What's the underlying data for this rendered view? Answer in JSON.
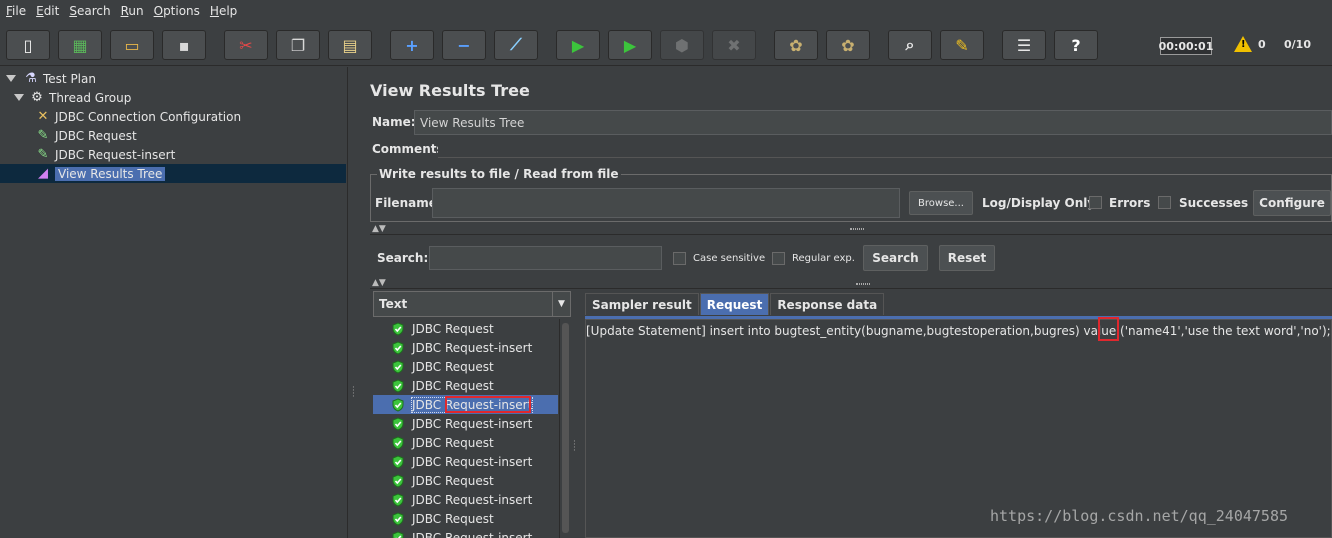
{
  "menu": [
    "File",
    "Edit",
    "Search",
    "Run",
    "Options",
    "Help"
  ],
  "toolbar": {
    "buttons": [
      {
        "name": "new-icon",
        "glyph": "▯",
        "color": "#f2f2f2"
      },
      {
        "name": "templates-icon",
        "glyph": "▦",
        "color": "#5ab55a"
      },
      {
        "name": "open-icon",
        "glyph": "▭",
        "color": "#e8b64a"
      },
      {
        "name": "save-icon",
        "glyph": "▪",
        "color": "#d8d8d8"
      },
      {
        "name": "cut-icon",
        "glyph": "✂",
        "color": "#e84848"
      },
      {
        "name": "copy-icon",
        "glyph": "❐",
        "color": "#d8d8d8"
      },
      {
        "name": "paste-icon",
        "glyph": "▤",
        "color": "#e8d08a"
      },
      {
        "name": "expand-icon",
        "glyph": "+",
        "color": "#5aa0ff"
      },
      {
        "name": "collapse-icon",
        "glyph": "−",
        "color": "#5aa0ff"
      },
      {
        "name": "toggle-icon",
        "glyph": "⟋",
        "color": "#8ad0ff"
      },
      {
        "name": "start-icon",
        "glyph": "▶",
        "color": "#3cc43c"
      },
      {
        "name": "start-no-pauses-icon",
        "glyph": "▶",
        "color": "#3cc43c"
      },
      {
        "name": "stop-icon",
        "glyph": "⬢",
        "color": "#9a9a9a"
      },
      {
        "name": "shutdown-icon",
        "glyph": "✖",
        "color": "#9a9a9a"
      },
      {
        "name": "clear-icon",
        "glyph": "✿",
        "color": "#c8b070"
      },
      {
        "name": "clear-all-icon",
        "glyph": "✿",
        "color": "#c8b070"
      },
      {
        "name": "search-icon",
        "glyph": "⌕",
        "color": "#e6e6e6"
      },
      {
        "name": "reset-search-icon",
        "glyph": "✎",
        "color": "#f0c020"
      },
      {
        "name": "function-helper-icon",
        "glyph": "☰",
        "color": "#e6e6e6"
      },
      {
        "name": "help-icon",
        "glyph": "?",
        "color": "#ffffff"
      }
    ],
    "timer": "00:00:01",
    "warnings": "0",
    "threads": "0/10"
  },
  "tree": [
    {
      "label": "Test Plan",
      "icon": "flask-icon",
      "level": 0,
      "expanded": true
    },
    {
      "label": "Thread Group",
      "icon": "gear-icon",
      "level": 1,
      "expanded": true
    },
    {
      "label": "JDBC Connection Configuration",
      "icon": "wrench-icon",
      "level": 2
    },
    {
      "label": "JDBC Request",
      "icon": "pipette-icon",
      "level": 2
    },
    {
      "label": "JDBC Request-insert",
      "icon": "pipette-icon",
      "level": 2
    },
    {
      "label": "View Results Tree",
      "icon": "graph-icon",
      "level": 2,
      "selected": true
    }
  ],
  "panel": {
    "title": "View Results Tree",
    "name_label": "Name:",
    "name_value": "View Results Tree",
    "comments_label": "Comments:",
    "file_group_title": "Write results to file / Read from file",
    "filename_label": "Filename",
    "browse_label": "Browse...",
    "log_display_label": "Log/Display Only:",
    "errors_label": "Errors",
    "successes_label": "Successes",
    "configure_label": "Configure",
    "search_label": "Search:",
    "case_sensitive_label": "Case sensitive",
    "regular_exp_label": "Regular exp.",
    "search_button": "Search",
    "reset_button": "Reset",
    "renderer": "Text"
  },
  "results": [
    "JDBC Request",
    "JDBC Request-insert",
    "JDBC Request",
    "JDBC Request",
    "JDBC Request-insert",
    "JDBC Request-insert",
    "JDBC Request",
    "JDBC Request-insert",
    "JDBC Request",
    "JDBC Request-insert",
    "JDBC Request",
    "JDBC Request-insert"
  ],
  "selected_result_index": 4,
  "tabs": [
    {
      "label": "Sampler result",
      "active": false
    },
    {
      "label": "Request",
      "active": true
    },
    {
      "label": "Response data",
      "active": false
    }
  ],
  "request_text": "[Update Statement] insert into bugtest_entity(bugname,bugtestoperation,bugres) value ('name41','use the text word','no');",
  "watermark": "https://blog.csdn.net/qq_24047585",
  "colors": {
    "accent": "#4b6eaf",
    "background": "#3c3f41",
    "highlight": "#e0282e",
    "success": "#3cc43c"
  }
}
